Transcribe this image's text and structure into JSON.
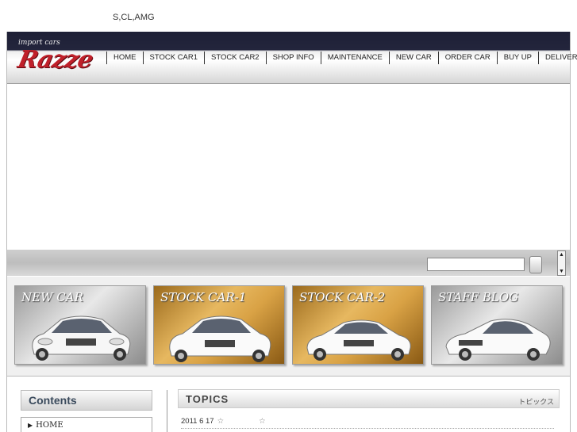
{
  "site": {
    "tagline": "S,CL,AMG",
    "logo_small": "import cars",
    "logo_big": "Razze"
  },
  "nav": {
    "items": [
      "HOME",
      "STOCK CAR1",
      "STOCK CAR2",
      "SHOP INFO",
      "MAINTENANCE",
      "NEW CAR",
      "ORDER CAR",
      "BUY UP",
      "DELIVERY"
    ]
  },
  "search": {
    "value": "",
    "placeholder": ""
  },
  "scroller": {
    "up": "▲",
    "down": "▼"
  },
  "banners": [
    {
      "title": "NEW CAR",
      "style": "gray"
    },
    {
      "title": "STOCK CAR-1",
      "style": "gold"
    },
    {
      "title": "STOCK CAR-2",
      "style": "gold"
    },
    {
      "title": "STAFF BLOG",
      "style": "gray"
    }
  ],
  "sidebar": {
    "title": "Contents",
    "items": [
      {
        "label": "HOME",
        "arrow": "▶"
      }
    ]
  },
  "topics": {
    "title": "TOPICS",
    "subtitle_jp": "トピックス",
    "entries": [
      {
        "date": "2011 6 17",
        "star1": "☆",
        "star2": "☆"
      }
    ]
  }
}
